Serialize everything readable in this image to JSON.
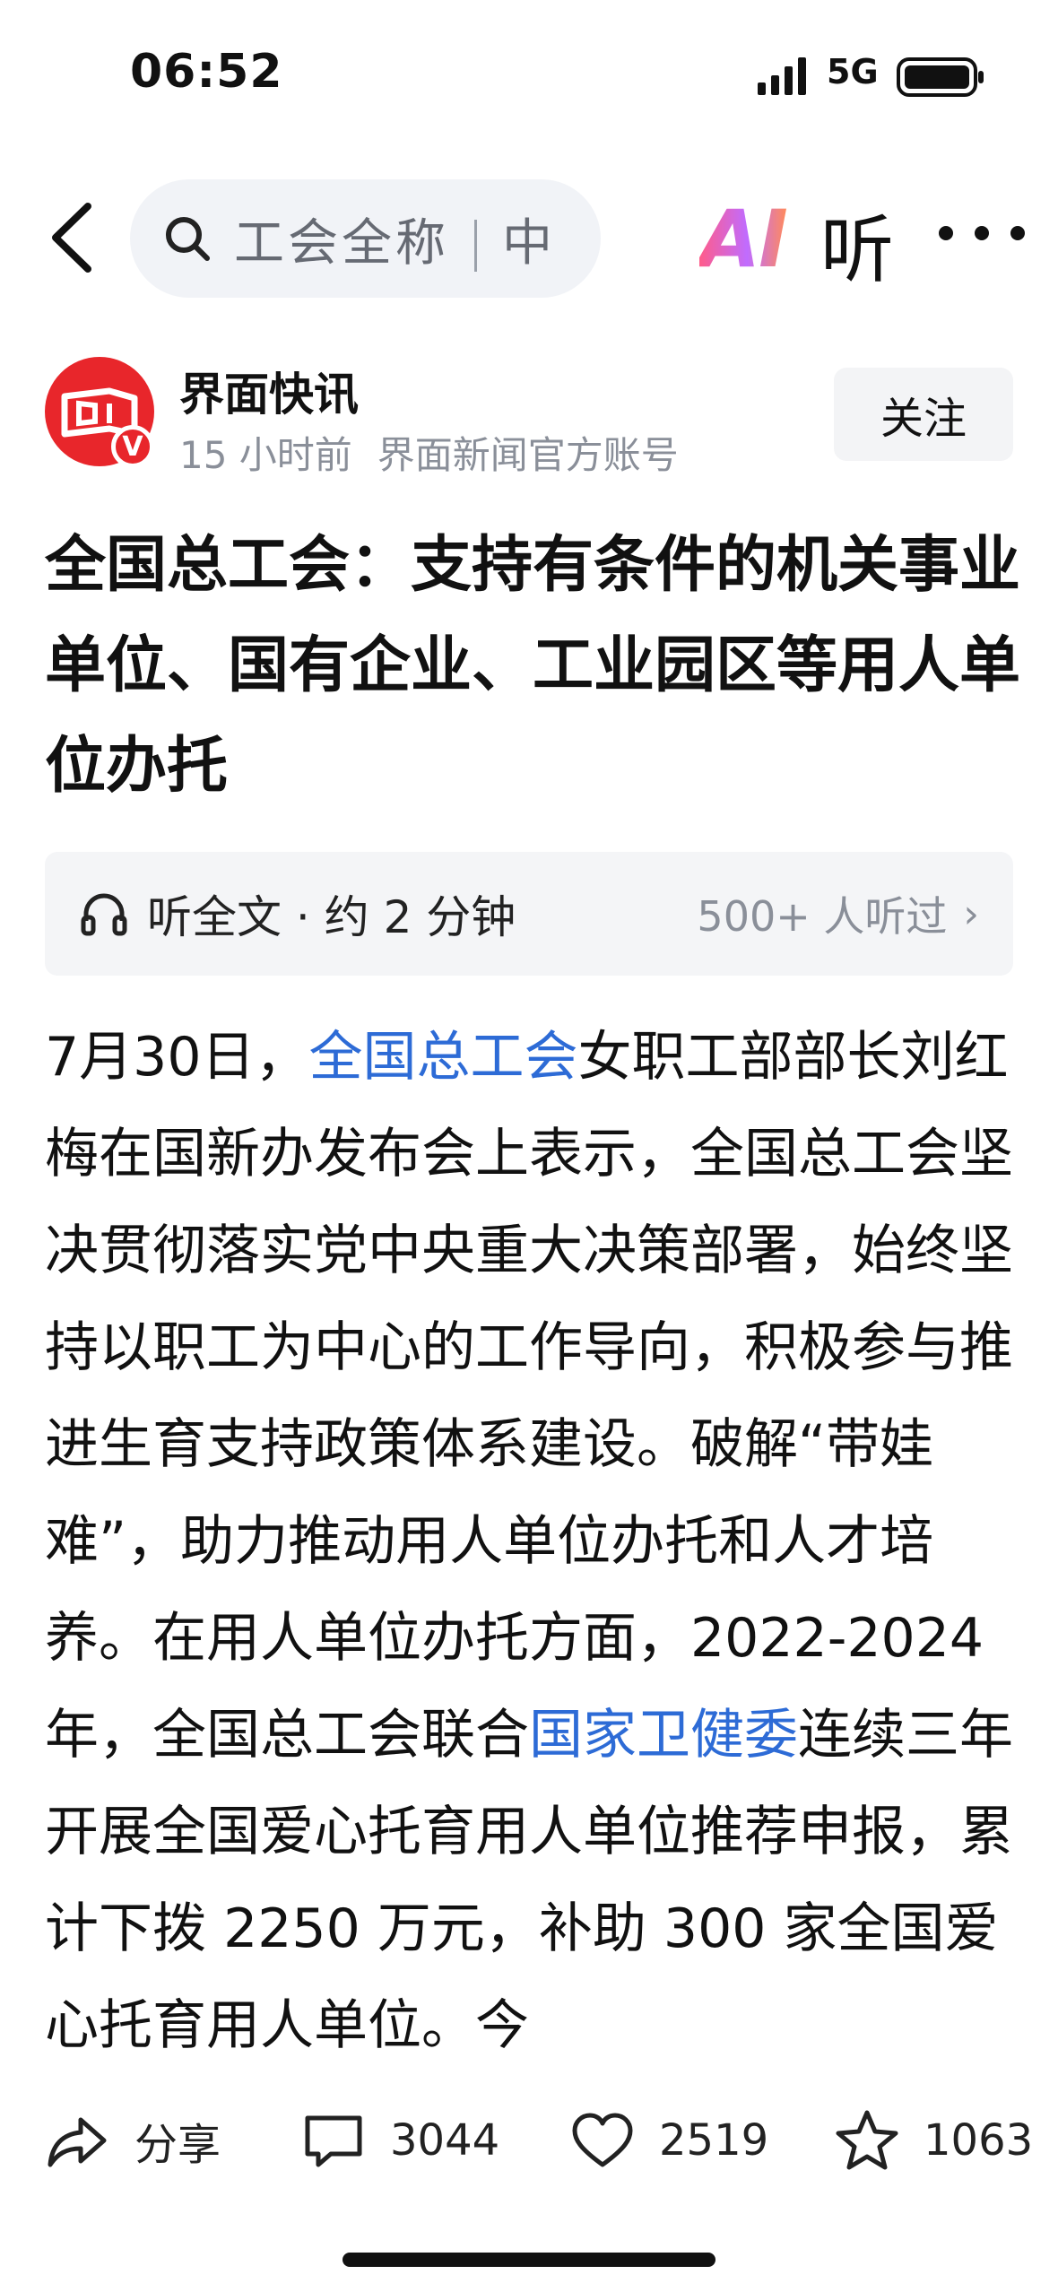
{
  "status_bar": {
    "time": "06:52",
    "network": "5G",
    "icons": [
      "signal-icon",
      "battery-icon"
    ]
  },
  "top_bar": {
    "back_icon": "chevron-left-icon",
    "search": {
      "text": "工会全称",
      "trailing": "中",
      "icon": "search-icon"
    },
    "ai_label": "AI",
    "listen_label": "听",
    "more_icon": "more-icon"
  },
  "author": {
    "name": "界面快讯",
    "time": "15 小时前",
    "desc": "界面新闻官方账号",
    "badge": "V",
    "follow_label": "关注"
  },
  "article": {
    "title": "全国总工会：支持有条件的机关事业单位、国有企业、工业园区等用人单位办托",
    "listen_bar": {
      "label": "听全文 · 约 2 分钟",
      "count": "500+ 人听过",
      "icon": "headphones-icon"
    },
    "body": {
      "t1": "7月30日，",
      "link1": "全国总工会",
      "t2": "女职工部部长刘红梅在国新办发布会上表示，全国总工会坚决贯彻落实党中央重大决策部署，始终坚持以职工为中心的工作导向，积极参与推进生育支持政策体系建设。破解“带娃难”，助力推动用人单位办托和人才培养。在用人单位办托方面，2022-2024 年，全国总工会联合",
      "link2": "国家卫健委",
      "t3": "连续三年开展全国爱心托育用人单位推荐申报，累计下拨 2250 万元，补助 300 家全国爱心托育用人单位。今"
    }
  },
  "bottom_bar": {
    "share_label": "分享",
    "comment_count": "3044",
    "like_count": "2519",
    "favorite_count": "1063"
  },
  "colors": {
    "link": "#2d6bd6",
    "brand_red": "#e8262b",
    "muted": "#8a8f99"
  }
}
